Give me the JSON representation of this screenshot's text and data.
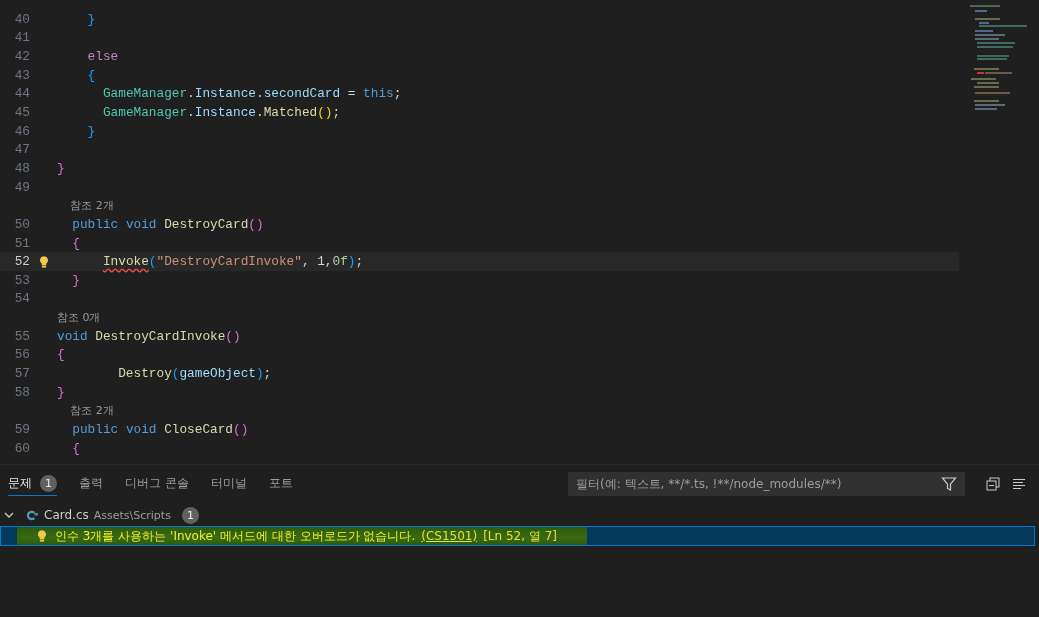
{
  "editor": {
    "lines": [
      {
        "number": "40",
        "current": false,
        "tokens": [
          {
            "text": "    }",
            "kind": "brace3"
          }
        ]
      },
      {
        "number": "41",
        "current": false
      },
      {
        "number": "42",
        "current": false,
        "tokens": [
          {
            "text": "    else",
            "kind": "control"
          }
        ]
      },
      {
        "number": "43",
        "current": false,
        "tokens": [
          {
            "text": "    {",
            "kind": "brace3"
          }
        ]
      },
      {
        "number": "44",
        "current": false,
        "tokens": [
          {
            "text": "      GameManager",
            "kind": "type"
          },
          {
            "text": ".",
            "kind": "plain"
          },
          {
            "text": "Instance",
            "kind": "prop"
          },
          {
            "text": ".",
            "kind": "plain"
          },
          {
            "text": "secondCard",
            "kind": "prop"
          },
          {
            "text": " = ",
            "kind": "plain"
          },
          {
            "text": "this",
            "kind": "keyword"
          },
          {
            "text": ";",
            "kind": "plain"
          }
        ]
      },
      {
        "number": "45",
        "current": false,
        "tokens": [
          {
            "text": "      GameManager",
            "kind": "type"
          },
          {
            "text": ".",
            "kind": "plain"
          },
          {
            "text": "Instance",
            "kind": "prop"
          },
          {
            "text": ".",
            "kind": "plain"
          },
          {
            "text": "Matched",
            "kind": "method"
          },
          {
            "text": "()",
            "kind": "brace1"
          },
          {
            "text": ";",
            "kind": "plain"
          }
        ]
      },
      {
        "number": "46",
        "current": false,
        "tokens": [
          {
            "text": "    }",
            "kind": "brace3"
          }
        ]
      },
      {
        "number": "47",
        "current": false
      },
      {
        "number": "48",
        "current": false,
        "tokens": [
          {
            "text": "}",
            "kind": "brace2"
          }
        ]
      },
      {
        "number": "49",
        "current": false
      },
      {
        "number": "50",
        "current": false,
        "codelens": "참조 2개",
        "tokens": [
          {
            "text": "  public ",
            "kind": "keyword"
          },
          {
            "text": "void ",
            "kind": "keyword"
          },
          {
            "text": "DestroyCard",
            "kind": "method"
          },
          {
            "text": "()",
            "kind": "brace2"
          }
        ]
      },
      {
        "number": "51",
        "current": false,
        "tokens": [
          {
            "text": "  {",
            "kind": "brace2"
          }
        ]
      },
      {
        "number": "52",
        "current": true,
        "lightbulb": true,
        "tokens": [
          {
            "text": "      Invoke",
            "kind": "method",
            "error": true
          },
          {
            "text": "(",
            "kind": "brace3"
          },
          {
            "text": "\"DestroyCardInvoke\"",
            "kind": "string"
          },
          {
            "text": ", 1,",
            "kind": "plain"
          },
          {
            "text": "0f",
            "kind": "number"
          },
          {
            "text": ")",
            "kind": "brace3"
          },
          {
            "text": ";",
            "kind": "plain"
          }
        ]
      },
      {
        "number": "53",
        "current": false,
        "tokens": [
          {
            "text": "  }",
            "kind": "brace2"
          }
        ]
      },
      {
        "number": "54",
        "current": false
      },
      {
        "number": "55",
        "current": false,
        "codelens": "참조 0개",
        "tokens": [
          {
            "text": "void ",
            "kind": "keyword"
          },
          {
            "text": "DestroyCardInvoke",
            "kind": "method"
          },
          {
            "text": "()",
            "kind": "brace2"
          }
        ]
      },
      {
        "number": "56",
        "current": false,
        "tokens": [
          {
            "text": "{",
            "kind": "brace2"
          }
        ]
      },
      {
        "number": "57",
        "current": false,
        "tokens": [
          {
            "text": "        Destroy",
            "kind": "method"
          },
          {
            "text": "(",
            "kind": "brace3"
          },
          {
            "text": "gameObject",
            "kind": "prop"
          },
          {
            "text": ")",
            "kind": "brace3"
          },
          {
            "text": ";",
            "kind": "plain"
          }
        ]
      },
      {
        "number": "58",
        "current": false,
        "tokens": [
          {
            "text": "}",
            "kind": "brace2"
          }
        ]
      },
      {
        "number": "59",
        "current": false,
        "codelens": "참조 2개",
        "tokens": [
          {
            "text": "  public ",
            "kind": "keyword"
          },
          {
            "text": "void ",
            "kind": "keyword"
          },
          {
            "text": "CloseCard",
            "kind": "method"
          },
          {
            "text": "()",
            "kind": "brace2"
          }
        ]
      },
      {
        "number": "60",
        "current": false,
        "tokens": [
          {
            "text": "  {",
            "kind": "brace2"
          }
        ]
      }
    ]
  },
  "panel": {
    "tabs": [
      {
        "label": "문제",
        "selected": true,
        "badge": "1"
      },
      {
        "label": "출력",
        "selected": false
      },
      {
        "label": "디버그 콘솔",
        "selected": false
      },
      {
        "label": "터미널",
        "selected": false
      },
      {
        "label": "포트",
        "selected": false
      }
    ],
    "filter": {
      "placeholder": "필터(예: 텍스트, **/*.ts, !**/node_modules/**)"
    },
    "files": [
      {
        "name": "Card.cs",
        "path": "Assets\\Scripts",
        "count": "1",
        "expanded": true,
        "problems": [
          {
            "message": "인수 3개를 사용하는 'Invoke' 메서드에 대한 오버로드가 없습니다.",
            "code": "(CS1501)",
            "location": "[Ln 52, 열 7]",
            "selected": true,
            "highlighted": true
          }
        ]
      }
    ]
  }
}
